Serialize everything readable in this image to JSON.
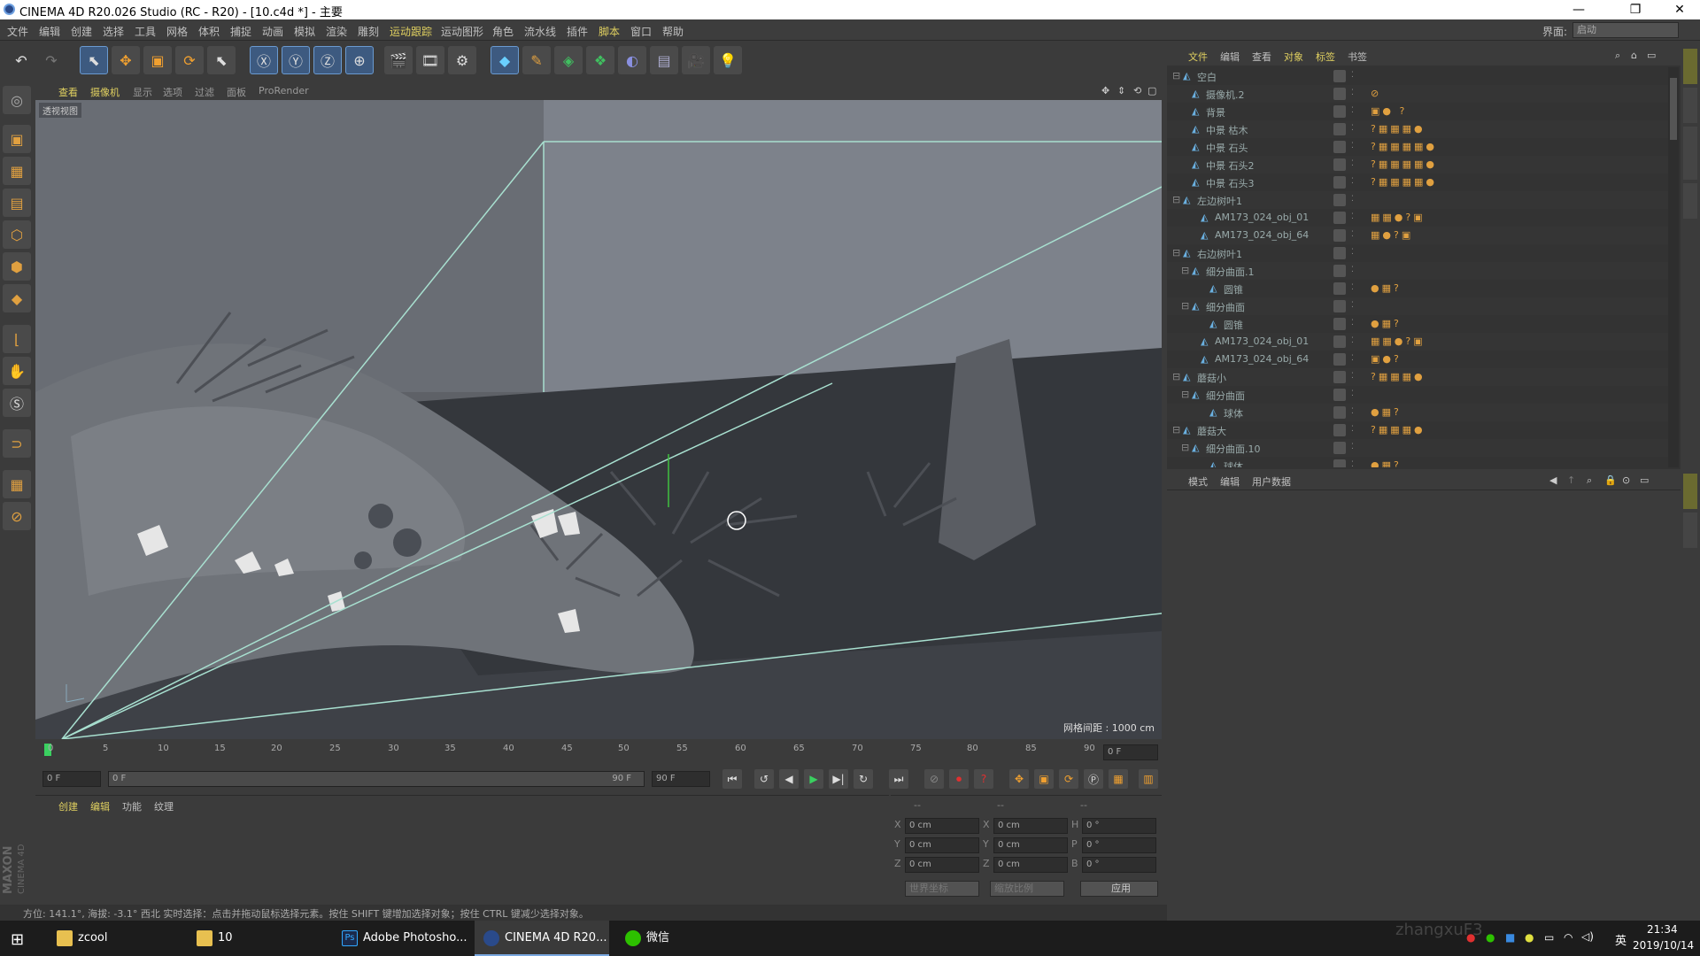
{
  "window": {
    "title": "CINEMA 4D R20.026 Studio (RC - R20) - [10.c4d *] - 主要"
  },
  "menubar": {
    "items": [
      "文件",
      "编辑",
      "创建",
      "选择",
      "工具",
      "网格",
      "体积",
      "捕捉",
      "动画",
      "模拟",
      "渲染",
      "雕刻",
      "运动跟踪",
      "运动图形",
      "角色",
      "流水线",
      "插件",
      "脚本",
      "窗口",
      "帮助"
    ],
    "interface_label": "界面:",
    "interface_value": "启动"
  },
  "viewport": {
    "menu": [
      "查看",
      "摄像机",
      "显示",
      "选项",
      "过滤",
      "面板",
      "ProRender"
    ],
    "view_label": "透视视图",
    "grid_info": "网格间距 : 1000 cm"
  },
  "timeline": {
    "ticks": [
      "0",
      "5",
      "10",
      "15",
      "20",
      "25",
      "30",
      "35",
      "40",
      "45",
      "50",
      "55",
      "60",
      "65",
      "70",
      "75",
      "80",
      "85",
      "90"
    ],
    "current_frame": "0 F",
    "start_field": "0 F",
    "range_start": "0 F",
    "range_end": "90 F",
    "end_field": "90 F"
  },
  "material": {
    "menu": [
      "创建",
      "编辑",
      "功能",
      "纹理"
    ]
  },
  "coords": {
    "headers": [
      "--",
      "--",
      "--"
    ],
    "rows": [
      {
        "a": "X",
        "av": "0 cm",
        "b": "X",
        "bv": "0 cm",
        "c": "H",
        "cv": "0 °"
      },
      {
        "a": "Y",
        "av": "0 cm",
        "b": "Y",
        "bv": "0 cm",
        "c": "P",
        "cv": "0 °"
      },
      {
        "a": "Z",
        "av": "0 cm",
        "b": "Z",
        "bv": "0 cm",
        "c": "B",
        "cv": "0 °"
      }
    ],
    "world_dropdown": "世界坐标",
    "scale_dropdown": "缩放比例",
    "apply": "应用"
  },
  "status": {
    "text": "方位: 141.1°, 海拔: -3.1° 西北   实时选择：点击并拖动鼠标选择元素。按住 SHIFT 键增加选择对象；按住 CTRL 键减少选择对象。"
  },
  "object_manager": {
    "menu": [
      "文件",
      "编辑",
      "查看",
      "对象",
      "标签",
      "书签"
    ],
    "objects": [
      {
        "name": "空白",
        "indent": 0,
        "expand": "⊟",
        "tags": ""
      },
      {
        "name": "摄像机.2",
        "indent": 1,
        "expand": "",
        "tags": "⊘"
      },
      {
        "name": "背景",
        "indent": 1,
        "expand": "",
        "tags": "▣● ?"
      },
      {
        "name": "中景 枯木",
        "indent": 1,
        "expand": "",
        "tags": "?▦▦▦●"
      },
      {
        "name": "中景 石头",
        "indent": 1,
        "expand": "",
        "tags": "?▦▦▦▦●"
      },
      {
        "name": "中景 石头2",
        "indent": 1,
        "expand": "",
        "tags": "?▦▦▦▦●"
      },
      {
        "name": "中景 石头3",
        "indent": 1,
        "expand": "",
        "tags": "?▦▦▦▦●"
      },
      {
        "name": "左边树叶1",
        "indent": 0,
        "expand": "⊟",
        "tags": ""
      },
      {
        "name": "AM173_024_obj_01",
        "indent": 2,
        "expand": "",
        "tags": "▦▦●?▣"
      },
      {
        "name": "AM173_024_obj_64",
        "indent": 2,
        "expand": "",
        "tags": "▦●?▣"
      },
      {
        "name": "右边树叶1",
        "indent": 0,
        "expand": "⊟",
        "tags": ""
      },
      {
        "name": "细分曲面.1",
        "indent": 1,
        "expand": "⊟",
        "tags": ""
      },
      {
        "name": "圆锥",
        "indent": 3,
        "expand": "",
        "tags": "●▦?"
      },
      {
        "name": "细分曲面",
        "indent": 1,
        "expand": "⊟",
        "tags": ""
      },
      {
        "name": "圆锥",
        "indent": 3,
        "expand": "",
        "tags": "●▦?"
      },
      {
        "name": "AM173_024_obj_01",
        "indent": 2,
        "expand": "",
        "tags": "▦▦●?▣"
      },
      {
        "name": "AM173_024_obj_64",
        "indent": 2,
        "expand": "",
        "tags": "▣●?"
      },
      {
        "name": "蘑菇小",
        "indent": 0,
        "expand": "⊟",
        "tags": "?▦▦▦●"
      },
      {
        "name": "细分曲面",
        "indent": 1,
        "expand": "⊟",
        "tags": ""
      },
      {
        "name": "球体",
        "indent": 3,
        "expand": "",
        "tags": "●▦?"
      },
      {
        "name": "蘑菇大",
        "indent": 0,
        "expand": "⊟",
        "tags": "?▦▦▦●"
      },
      {
        "name": "细分曲面.10",
        "indent": 1,
        "expand": "⊟",
        "tags": ""
      },
      {
        "name": "球体",
        "indent": 3,
        "expand": "",
        "tags": "●▦?"
      }
    ]
  },
  "attribute_manager": {
    "menu": [
      "模式",
      "编辑",
      "用户数据"
    ]
  },
  "branding": {
    "brand": "MAXON",
    "product": "CINEMA 4D"
  },
  "taskbar": {
    "items": [
      "zcool",
      "10",
      "Adobe Photosho...",
      "CINEMA 4D R20...",
      "微信"
    ],
    "watermark": "zhangxuF3",
    "ime": "英",
    "time": "21:34",
    "date": "2019/10/14"
  }
}
